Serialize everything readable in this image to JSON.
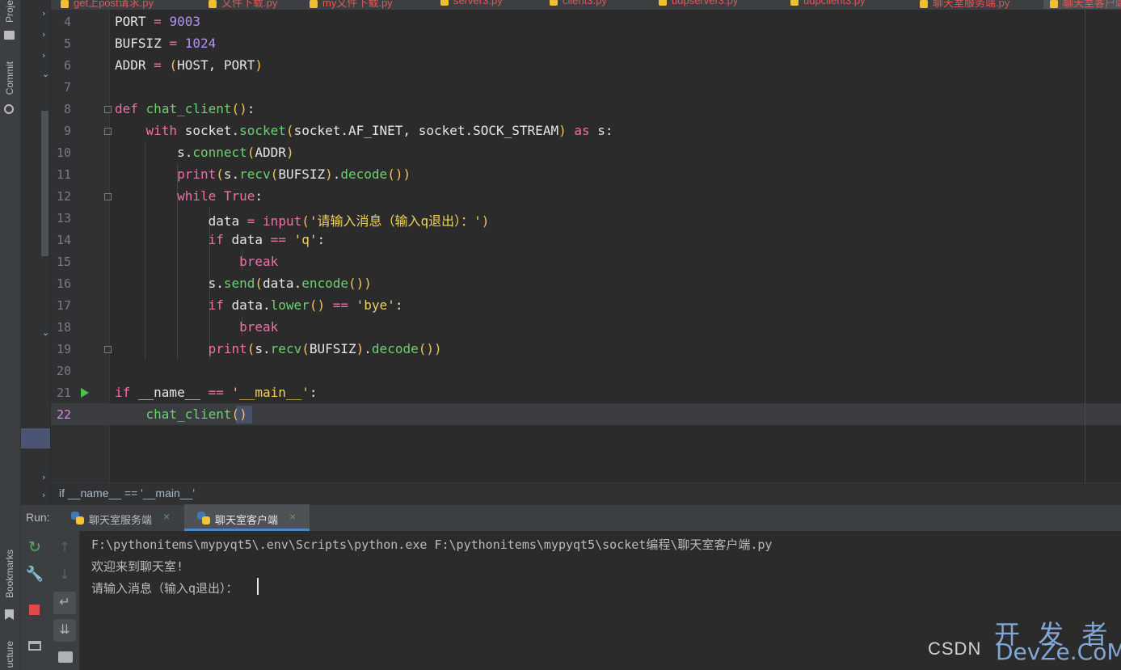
{
  "left_strip": {
    "project": "Proje",
    "commit": "Commit",
    "bookmarks": "Bookmarks",
    "structure": "ucture"
  },
  "tabs": [
    "get上post请求.py",
    "文件下载.py",
    "my文件下载.py",
    "server3.py",
    "client3.py",
    "udpserver3.py",
    "udpclient3.py",
    "聊天室服务端.py",
    "聊天室客户端.py"
  ],
  "editor": {
    "current_line": 22,
    "lines": [
      {
        "num": "4",
        "code": "PORT = 9003"
      },
      {
        "num": "5",
        "code": "BUFSIZ = 1024"
      },
      {
        "num": "6",
        "code": "ADDR = (HOST, PORT)"
      },
      {
        "num": "7",
        "code": ""
      },
      {
        "num": "8",
        "code": "def chat_client():"
      },
      {
        "num": "9",
        "code": "    with socket.socket(socket.AF_INET, socket.SOCK_STREAM) as s:"
      },
      {
        "num": "10",
        "code": "        s.connect(ADDR)"
      },
      {
        "num": "11",
        "code": "        print(s.recv(BUFSIZ).decode())"
      },
      {
        "num": "12",
        "code": "        while True:"
      },
      {
        "num": "13",
        "code": "            data = input('请输入消息（输入q退出）：')"
      },
      {
        "num": "14",
        "code": "            if data == 'q':"
      },
      {
        "num": "15",
        "code": "                break"
      },
      {
        "num": "16",
        "code": "            s.send(data.encode())"
      },
      {
        "num": "17",
        "code": "            if data.lower() == 'bye':"
      },
      {
        "num": "18",
        "code": "                break"
      },
      {
        "num": "19",
        "code": "            print(s.recv(BUFSIZ).decode())"
      },
      {
        "num": "20",
        "code": ""
      },
      {
        "num": "21",
        "code": "if __name__ == '__main__':"
      },
      {
        "num": "22",
        "code": "    chat_client()"
      }
    ]
  },
  "breadcrumb": "if __name__ == '__main__'",
  "run": {
    "label": "Run:",
    "tabs": [
      {
        "label": "聊天室服务端",
        "close": "×",
        "active": false
      },
      {
        "label": "聊天室客户端",
        "close": "×",
        "active": true
      }
    ],
    "console_lines": [
      "F:\\pythonitems\\mypyqt5\\.env\\Scripts\\python.exe F:\\pythonitems\\mypyqt5\\socket编程\\聊天室客户端.py",
      "欢迎来到聊天室!",
      "请输入消息（输入q退出）："
    ]
  },
  "toolbar_icons": [
    "rerun-icon",
    "wrench-icon",
    "stop-icon",
    "layout-icon",
    "up-arrow-icon",
    "down-arrow-icon",
    "soft-wrap-icon",
    "scroll-to-end-icon",
    "print-icon"
  ],
  "colors": {
    "keyword": "#f06fa8",
    "number": "#b392f0",
    "function": "#6ad26e",
    "string": "#f0d25a",
    "accent": "#4a88c7"
  },
  "watermark": {
    "csdn": "CSDN",
    "cn": "开 发 者",
    "en": "DevZe.CoM"
  }
}
